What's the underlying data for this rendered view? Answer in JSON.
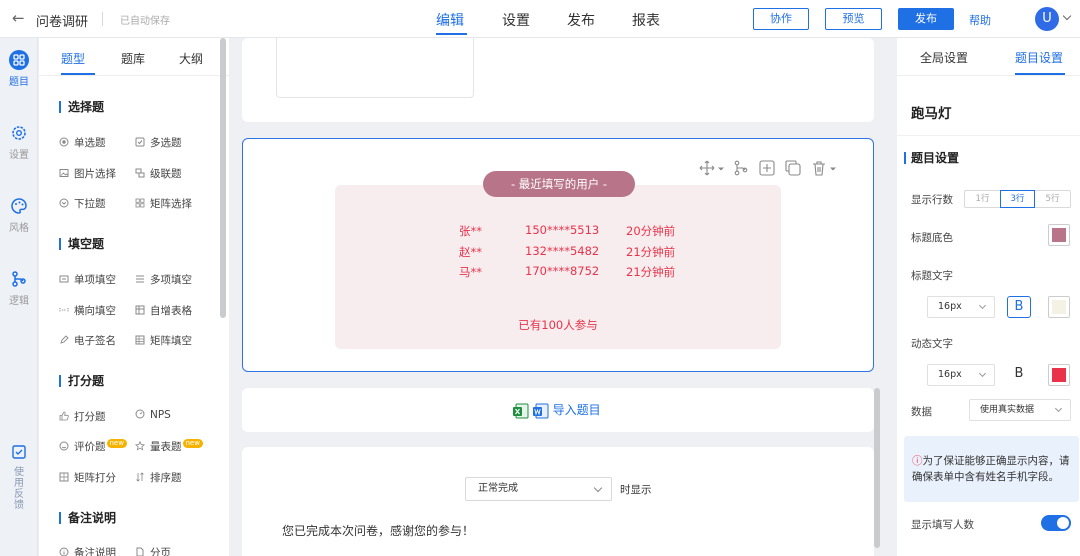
{
  "header": {
    "back_icon": "arrow-left-icon",
    "title": "问卷调研",
    "autosave": "已自动保存",
    "tabs": [
      "编辑",
      "设置",
      "发布",
      "报表"
    ],
    "active_tab": "编辑",
    "collab": "协作",
    "preview": "预览",
    "publish": "发布",
    "help": "帮助",
    "avatar": "U"
  },
  "leftbar": {
    "items": [
      {
        "label": "题目",
        "icon": "grid-icon",
        "active": true
      },
      {
        "label": "设置",
        "icon": "gear-icon"
      },
      {
        "label": "风格",
        "icon": "palette-icon"
      },
      {
        "label": "逻辑",
        "icon": "logic-icon"
      }
    ],
    "feedback": "使用反馈"
  },
  "qpanel": {
    "tabs": [
      "题型",
      "题库",
      "大纲"
    ],
    "categories": [
      {
        "title": "选择题",
        "items": [
          "单选题",
          "多选题",
          "图片选择",
          "级联题",
          "下拉题",
          "矩阵选择"
        ]
      },
      {
        "title": "填空题",
        "items": [
          "单项填空",
          "多项填空",
          "横向填空",
          "自增表格",
          "电子签名",
          "矩阵填空"
        ]
      },
      {
        "title": "打分题",
        "items": [
          "打分题",
          "NPS",
          "评价题",
          "量表题",
          "矩阵打分",
          "排序题"
        ]
      },
      {
        "title": "备注说明",
        "items": [
          "备注说明",
          "分页"
        ]
      }
    ],
    "new_badge": "new"
  },
  "marquee": {
    "title": "- 最近填写的用户 -",
    "rows": [
      {
        "name": "张**",
        "phone": "150****5513",
        "time": "20分钟前"
      },
      {
        "name": "赵**",
        "phone": "132****5482",
        "time": "21分钟前"
      },
      {
        "name": "马**",
        "phone": "170****8752",
        "time": "21分钟前"
      }
    ],
    "footer": "已有100人参与"
  },
  "import": {
    "label": "导入题目"
  },
  "ending": {
    "select_value": "正常完成",
    "suffix": "时显示",
    "message": "您已完成本次问卷，感谢您的参与！"
  },
  "settings": {
    "tabs": [
      "全局设置",
      "题目设置"
    ],
    "heading": "跑马灯",
    "section": "题目设置",
    "rows_label": "显示行数",
    "rows_options": [
      "1行",
      "3行",
      "5行"
    ],
    "rows_selected": "3行",
    "title_bg_label": "标题底色",
    "title_bg_color": "#b8758a",
    "title_text_label": "标题文字",
    "title_font_size": "16px",
    "title_bold": "B",
    "title_text_color": "#f4f2e4",
    "dynamic_text_label": "动态文字",
    "dynamic_font_size": "16px",
    "dynamic_bold": "B",
    "dynamic_text_color": "#e8334a",
    "data_label": "数据",
    "data_value": "使用真实数据",
    "notice_icon": "ⓘ",
    "notice": "为了保证能够正确显示内容，请确保表单中含有姓名手机字段。",
    "show_count_label": "显示填写人数",
    "show_count_on": true
  },
  "colors": {
    "accent": "#1f6fe5",
    "marquee_red": "#e8334a",
    "marquee_bg": "#f7ecee"
  }
}
